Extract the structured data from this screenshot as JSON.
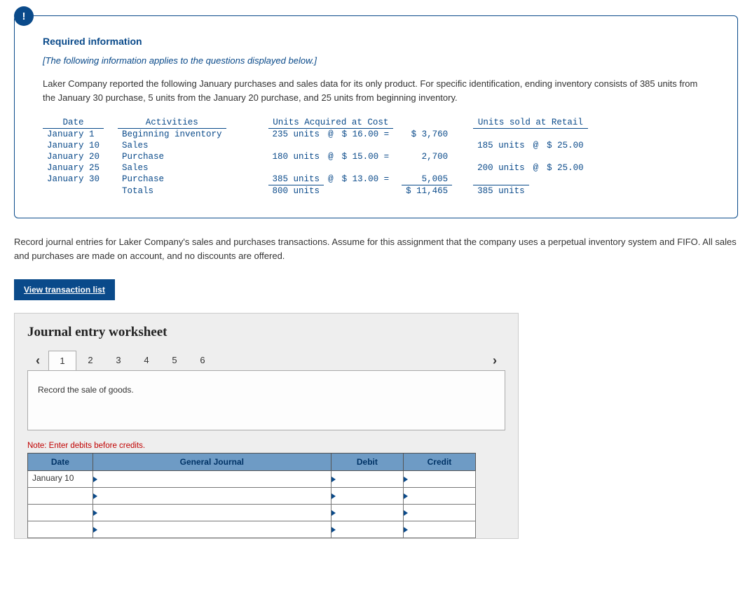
{
  "header": {
    "badge": "!",
    "title": "Required information",
    "italic": "[The following information applies to the questions displayed below.]",
    "body": "Laker Company reported the following January purchases and sales data for its only product. For specific identification, ending inventory consists of 385 units from the January 30 purchase, 5 units from the January 20 purchase, and 25 units from beginning inventory."
  },
  "table": {
    "head": {
      "date": "Date",
      "act": "Activities",
      "acq": "Units Acquired at Cost",
      "sold": "Units sold at Retail"
    },
    "rows": [
      {
        "date": "January 1",
        "act": "Beginning inventory",
        "units": "235 units",
        "at": "@",
        "price": "$ 16.00 =",
        "cost": "$ 3,760",
        "sunits": "",
        "sat": "",
        "sprice": ""
      },
      {
        "date": "January 10",
        "act": "Sales",
        "units": "",
        "at": "",
        "price": "",
        "cost": "",
        "sunits": "185 units",
        "sat": "@",
        "sprice": "$ 25.00"
      },
      {
        "date": "January 20",
        "act": "Purchase",
        "units": "180 units",
        "at": "@",
        "price": "$ 15.00 =",
        "cost": "2,700",
        "sunits": "",
        "sat": "",
        "sprice": ""
      },
      {
        "date": "January 25",
        "act": "Sales",
        "units": "",
        "at": "",
        "price": "",
        "cost": "",
        "sunits": "200 units",
        "sat": "@",
        "sprice": "$ 25.00"
      },
      {
        "date": "January 30",
        "act": "Purchase",
        "units": "385 units",
        "at": "@",
        "price": "$ 13.00 =",
        "cost": "5,005",
        "sunits": "",
        "sat": "",
        "sprice": ""
      }
    ],
    "totals": {
      "label": "Totals",
      "units": "800 units",
      "cost": "$ 11,465",
      "sunits": "385 units"
    }
  },
  "instructions": "Record journal entries for Laker Company's sales and purchases transactions. Assume for this assignment that the company uses a perpetual inventory system and FIFO. All sales and purchases are made on account, and no discounts are offered.",
  "viewBtn": "View transaction list",
  "worksheet": {
    "title": "Journal entry worksheet",
    "tabs": [
      "1",
      "2",
      "3",
      "4",
      "5",
      "6"
    ],
    "activeTab": 0,
    "prompt": "Record the sale of goods.",
    "note": "Note: Enter debits before credits.",
    "columns": {
      "date": "Date",
      "gj": "General Journal",
      "debit": "Debit",
      "credit": "Credit"
    },
    "rows": [
      {
        "date": "January 10",
        "gj": "",
        "debit": "",
        "credit": ""
      },
      {
        "date": "",
        "gj": "",
        "debit": "",
        "credit": ""
      },
      {
        "date": "",
        "gj": "",
        "debit": "",
        "credit": ""
      },
      {
        "date": "",
        "gj": "",
        "debit": "",
        "credit": ""
      }
    ]
  }
}
